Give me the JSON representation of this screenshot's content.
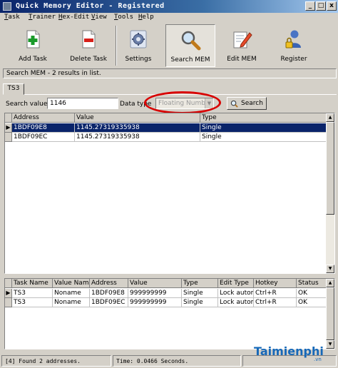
{
  "window": {
    "title": "Quick Memory Editor - Registered",
    "controls": [
      "_",
      "□",
      "x"
    ]
  },
  "menu": [
    "Task",
    "Trainer",
    "Hex-Edit",
    "View",
    "Tools",
    "Help"
  ],
  "toolbar": {
    "add_task": "Add Task",
    "delete_task": "Delete Task",
    "settings": "Settings",
    "search_mem": "Search MEM",
    "edit_mem": "Edit MEM",
    "register": "Register"
  },
  "status_line": "Search MEM - 2 results in list.",
  "tab": "TS3",
  "search": {
    "label": "Search value:",
    "value": "1146",
    "datatype_label": "Data type",
    "datatype_value": "Floating Number",
    "button": "Search"
  },
  "results": {
    "columns": [
      "Address",
      "Value",
      "Type"
    ],
    "rows": [
      [
        "1BDF09E8",
        "1145.27319335938",
        "Single"
      ],
      [
        "1BDF09EC",
        "1145.27319335938",
        "Single"
      ]
    ]
  },
  "tasks": {
    "columns": [
      "Task Name",
      "Value Name",
      "Address",
      "Value",
      "Type",
      "Edit Type",
      "Hotkey",
      "Status"
    ],
    "rows": [
      [
        "TS3",
        "Noname",
        "1BDF09E8",
        "999999999",
        "Single",
        "Lock automa",
        "Ctrl+R",
        "OK"
      ],
      [
        "TS3",
        "Noname",
        "1BDF09EC",
        "999999999",
        "Single",
        "Lock automa",
        "Ctrl+R",
        "OK"
      ]
    ]
  },
  "statusbar": {
    "found": "[4] Found 2 addresses.",
    "time": "Time:  0.0466 Seconds."
  },
  "watermark": {
    "text": "Taimienphi",
    "sub": ".vn"
  },
  "colors": {
    "title_bar": "#0a246a",
    "selection": "#0a246a",
    "highlight_ellipse": "#d80000",
    "watermark": "#1668b8"
  }
}
